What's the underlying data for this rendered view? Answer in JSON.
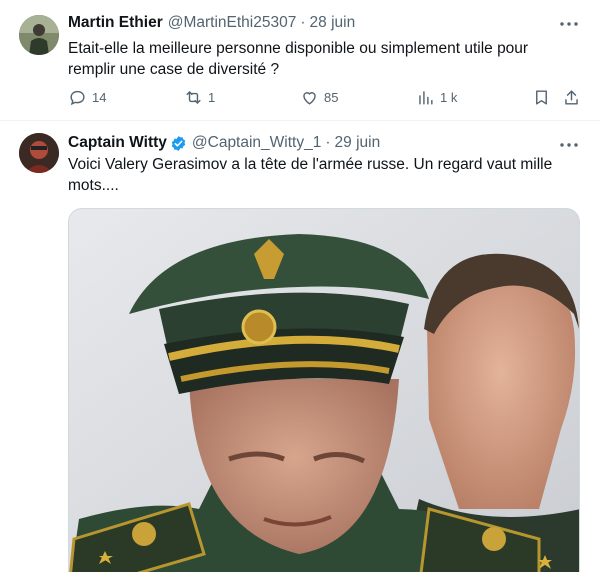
{
  "tweets": [
    {
      "author_name": "Martin Ethier",
      "handle": "@MartinEthi25307",
      "separator": "·",
      "date": "28 juin",
      "text": "Etait-elle la meilleure personne disponible ou simplement utile pour remplir une case de diversité ?",
      "replies": "14",
      "retweets": "1",
      "likes": "85",
      "views": "1 k",
      "avatar_icon": "user-avatar"
    },
    {
      "author_name": "Captain Witty",
      "handle": "@Captain_Witty_1",
      "separator": "·",
      "date": "29 juin",
      "text": "Voici Valery Gerasimov a la tête de l'armée russe. Un regard vaut mille mots....",
      "verified": true,
      "avatar_icon": "user-avatar",
      "media": "photo-military-officer"
    }
  ],
  "colors": {
    "secondary_text": "#536471",
    "verified_blue": "#1d9bf0",
    "divider": "#eff3f4"
  }
}
